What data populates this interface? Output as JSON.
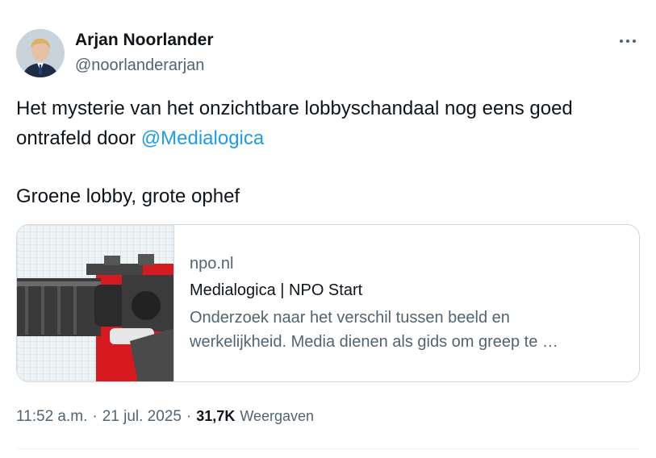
{
  "author": {
    "name": "Arjan Noorlander",
    "handle": "@noorlanderarjan"
  },
  "tweet": {
    "line1": "Het mysterie van het onzichtbare lobbyschandaal nog eens goed",
    "line2_prefix": "ontrafeld door ",
    "mention": "@Medialogica",
    "line3": "Groene lobby, grote ophef"
  },
  "card": {
    "domain": "npo.nl",
    "title": "Medialogica | NPO Start",
    "desc_line1": "Onderzoek naar het verschil tussen beeld en",
    "desc_line2": "werkelijkheid. Media dienen als gids om greep te …"
  },
  "meta": {
    "time": "11:52 a.m.",
    "sep1": "·",
    "date": "21 jul. 2025",
    "sep2": "·",
    "views_count": "31,7K",
    "views_label": "Weergaven"
  },
  "colors": {
    "text": "#0f1419",
    "secondary": "#536471",
    "link": "#1d9bf0",
    "border": "#cfd9de",
    "card_red": "#d71a1f"
  },
  "icons": {
    "more": "more-horizontal-icon"
  }
}
